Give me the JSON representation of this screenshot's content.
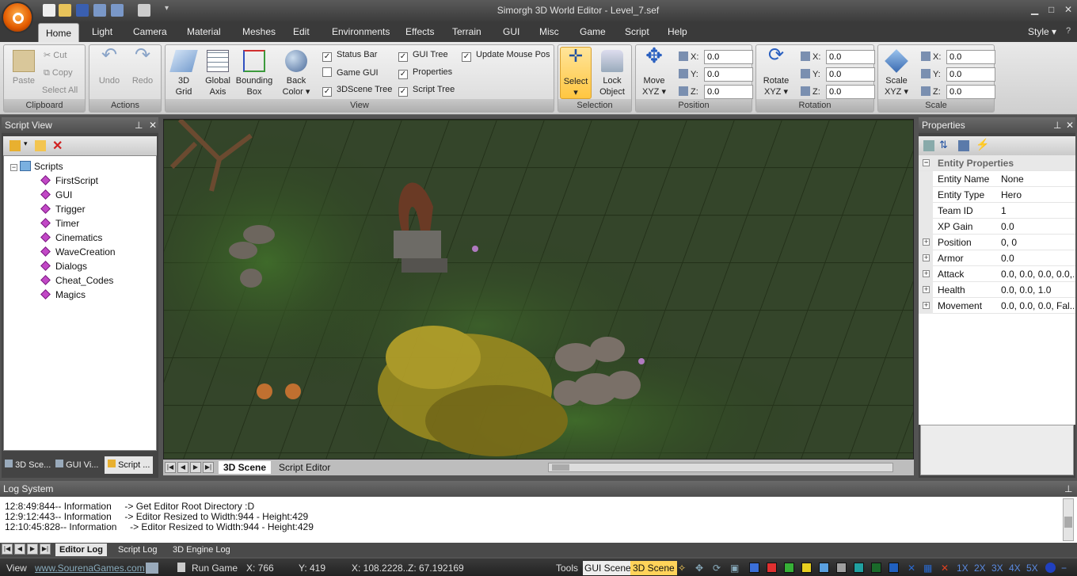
{
  "title": "Simorgh 3D World Editor - Level_7.sef",
  "menu": [
    "Light",
    "Camera",
    "Material",
    "Meshes",
    "Edit",
    "Environments",
    "Effects",
    "Terrain",
    "GUI",
    "Misc",
    "Game",
    "Script",
    "Help"
  ],
  "home_tab": "Home",
  "style_label": "Style",
  "clipboard": {
    "paste": "Paste",
    "cut": "Cut",
    "copy": "Copy",
    "select_all": "Select All",
    "caption": "Clipboard"
  },
  "actions": {
    "undo": "Undo",
    "redo": "Redo",
    "caption": "Actions"
  },
  "view": {
    "grid": "3D Grid",
    "axis": "Global Axis",
    "bbox": "Bounding Box",
    "back": "Back Color",
    "caption": "View",
    "checks": [
      {
        "label": "Status Bar",
        "checked": true
      },
      {
        "label": "Game GUI",
        "checked": false
      },
      {
        "label": "3DScene Tree",
        "checked": true
      },
      {
        "label": "GUI Tree",
        "checked": true
      },
      {
        "label": "Properties",
        "checked": true
      },
      {
        "label": "Script Tree",
        "checked": true
      },
      {
        "label": "Update Mouse Pos",
        "checked": true
      }
    ]
  },
  "selection": {
    "select": "Select",
    "lock": "Lock Object",
    "caption": "Selection"
  },
  "position": {
    "btn": "Move XYZ",
    "x": "0.0",
    "y": "0.0",
    "z": "0.0",
    "caption": "Position"
  },
  "rotation": {
    "btn": "Rotate XYZ",
    "x": "0.0",
    "y": "0.0",
    "z": "0.0",
    "caption": "Rotation"
  },
  "scale": {
    "btn": "Scale XYZ",
    "x": "0.0",
    "y": "0.0",
    "z": "0.0",
    "caption": "Scale"
  },
  "axis_labels": {
    "x": "X:",
    "y": "Y:",
    "z": "Z:"
  },
  "script_view": {
    "title": "Script View",
    "root": "Scripts",
    "items": [
      "FirstScript",
      "GUI",
      "Trigger",
      "Timer",
      "Cinematics",
      "WaveCreation",
      "Dialogs",
      "Cheat_Codes",
      "Magics"
    ],
    "tabs": [
      "3D Sce...",
      "GUI Vi...",
      "Script ..."
    ]
  },
  "scene_tabs": [
    "3D Scene",
    "Script Editor"
  ],
  "properties": {
    "title": "Properties",
    "category": "Entity Properties",
    "rows": [
      {
        "name": "Entity Name",
        "value": "None",
        "expandable": false
      },
      {
        "name": "Entity Type",
        "value": "Hero",
        "expandable": false
      },
      {
        "name": "Team ID",
        "value": "1",
        "expandable": false
      },
      {
        "name": "XP Gain",
        "value": "0.0",
        "expandable": false
      },
      {
        "name": "Position",
        "value": "0, 0",
        "expandable": true
      },
      {
        "name": "Armor",
        "value": "0.0",
        "expandable": true
      },
      {
        "name": "Attack",
        "value": "0.0, 0.0, 0.0, 0.0,...",
        "expandable": true
      },
      {
        "name": "Health",
        "value": "0.0, 0.0, 1.0",
        "expandable": true
      },
      {
        "name": "Movement",
        "value": "0.0, 0.0, 0.0, Fal...",
        "expandable": true
      }
    ]
  },
  "log": {
    "title": "Log System",
    "lines": [
      "12:8:49:844-- Information     -> Get Editor Root Directory :D",
      "12:9:12:443-- Information     -> Editor Resized to Width:944 - Height:429",
      "12:10:45:828-- Information     -> Editor Resized to Width:944 - Height:429"
    ],
    "tabs": [
      "Editor Log",
      "Script Log",
      "3D Engine Log"
    ]
  },
  "status": {
    "view": "View",
    "site": "www.SourenaGames.com",
    "run": "Run Game",
    "x": "X: 766",
    "y": "Y: 419",
    "px": "X: 108.2228...",
    "pz": "Z: 67.192169",
    "tools": "Tools",
    "gui_scene": "GUI Scene",
    "scene3d": "3D Scene",
    "zooms": [
      "1X",
      "2X",
      "3X",
      "4X",
      "5X"
    ]
  },
  "colors": [
    "#3b6fd8",
    "#e03030",
    "#37b037",
    "#e8d020",
    "#5aa0e0",
    "#a0a0a0",
    "#20a0a0",
    "#1a6a2a",
    "#2060c0"
  ]
}
